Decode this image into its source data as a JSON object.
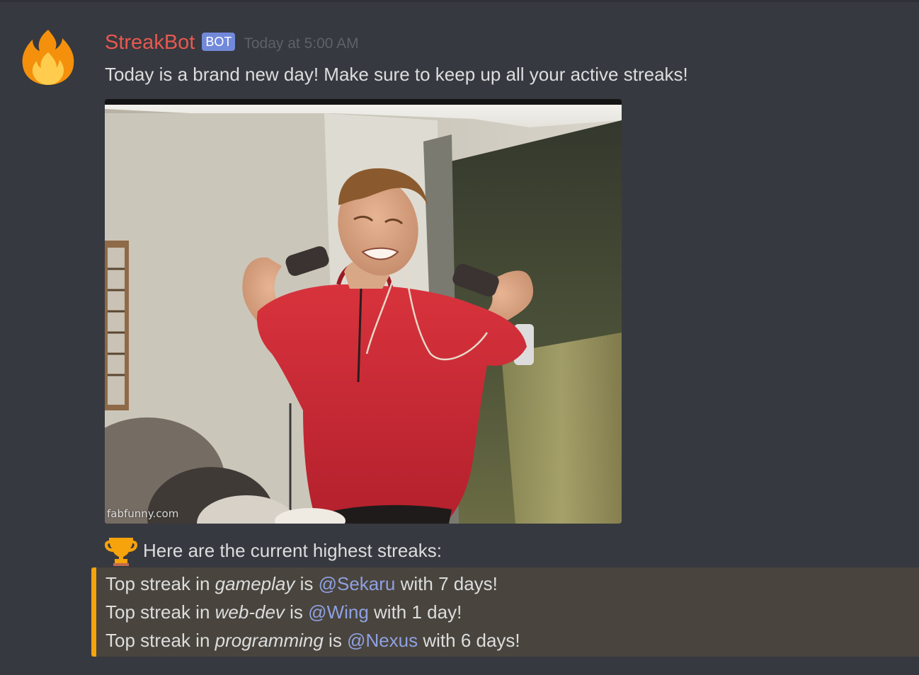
{
  "message": {
    "author": "StreakBot",
    "bot_tag": "BOT",
    "timestamp": "Today at 5:00 AM",
    "avatar_icon": "fire-icon",
    "content": "Today is a brand new day! Make sure to keep up all your active streaks!"
  },
  "gif": {
    "watermark": "fabfunny.com"
  },
  "streaks": {
    "intro": "Here are the current highest streaks:",
    "intro_icon": "trophy-icon",
    "accent_color": "#f6a30c",
    "mention_color": "#8ea1e1",
    "rows": [
      {
        "prefix": "Top streak in ",
        "channel": "gameplay",
        "is": " is ",
        "user": "@Sekaru",
        "suffix": " with 7 days!"
      },
      {
        "prefix": "Top streak in ",
        "channel": "web-dev",
        "is": " is ",
        "user": "@Wing",
        "suffix": " with 1 day!"
      },
      {
        "prefix": "Top streak in ",
        "channel": "programming",
        "is": " is ",
        "user": "@Nexus",
        "suffix": " with 6 days!"
      }
    ]
  },
  "colors": {
    "background": "#36393f",
    "username": "#e8584f",
    "bot_tag": "#7289da"
  }
}
